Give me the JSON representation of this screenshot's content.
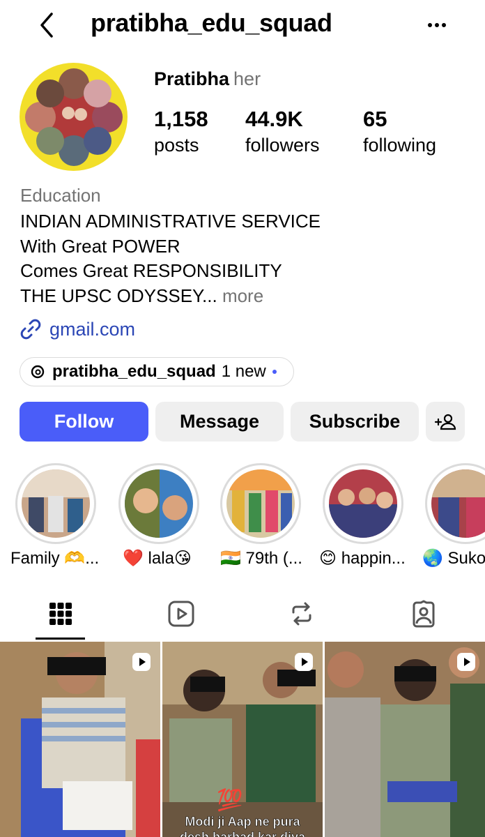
{
  "header": {
    "username": "pratibha_edu_squad"
  },
  "profile": {
    "name": "Pratibha",
    "pronouns": "her",
    "stats": [
      {
        "value": "1,158",
        "label": "posts"
      },
      {
        "value": "44.9K",
        "label": "followers"
      },
      {
        "value": "65",
        "label": "following"
      }
    ],
    "category": "Education",
    "bio_lines": [
      "INDIAN ADMINISTRATIVE SERVICE",
      "With Great POWER",
      "Comes Great RESPONSIBILITY",
      "THE UPSC ODYSSEY..."
    ],
    "bio_more": " more",
    "link": "gmail.com"
  },
  "threads": {
    "handle": "pratibha_edu_squad",
    "badge": "1 new"
  },
  "buttons": {
    "follow": "Follow",
    "message": "Message",
    "subscribe": "Subscribe"
  },
  "highlights": [
    {
      "label": "Family 🫶..."
    },
    {
      "label": "❤️ lala😘"
    },
    {
      "label": "🇮🇳 79th (..."
    },
    {
      "label": "😊 happin..."
    },
    {
      "label": "🌏 Suko"
    }
  ],
  "tabs": [
    "posts-grid",
    "reels",
    "reposts",
    "tagged"
  ],
  "grid": {
    "captions": [
      "Modi ji Aap ne pura",
      "desh barbad kar diya"
    ],
    "emoji": "💯"
  },
  "colors": {
    "accent": "#4a5df9",
    "link": "#2b46b5",
    "muted": "#737373"
  }
}
